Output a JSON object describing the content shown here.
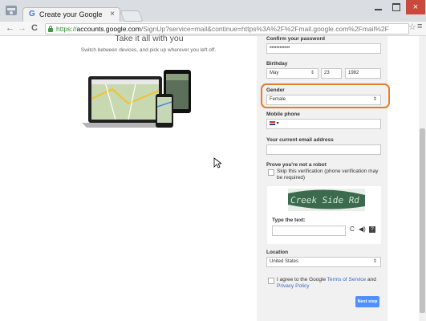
{
  "browser": {
    "tab_title": "Create your Google",
    "tab_close": "×",
    "favicon_letter": "G",
    "url_https": "https://",
    "url_host": "accounts.google.com",
    "url_rest": "/SignUp?service=mail&continue=https%3A%2F%2Fmail.google.com%2Fmail%2F",
    "back": "←",
    "forward": "→",
    "reload": "C",
    "close_glyph": "×"
  },
  "promo": {
    "headline": "Take it all with you",
    "subline": "Switch between devices, and pick up wherever you left off."
  },
  "form": {
    "confirm_password_label": "Confirm your password",
    "confirm_password_value": "••••••••••••",
    "birthday_label": "Birthday",
    "birth_month": "May",
    "birth_day": "23",
    "birth_year": "1982",
    "gender_label": "Gender",
    "gender_value": "Female",
    "mobile_label": "Mobile phone",
    "mobile_flag_caret": "▾",
    "email_label": "Your current email address",
    "robot_label": "Prove you're not a robot",
    "skip_verification": "Skip this verification (phone verification may be required)",
    "captcha_text": "Creek Side Rd",
    "type_text_label": "Type the text:",
    "location_label": "Location",
    "location_value": "United States",
    "agree_prefix": "I agree to the Google ",
    "agree_tos": "Terms of Service",
    "agree_and": " and",
    "agree_privacy": "Privacy Policy",
    "next_button": "Next step",
    "select_arrow": "⇕"
  },
  "colors": {
    "highlight": "#e07f2c",
    "next_button": "#4d90fe",
    "link": "#3366cc"
  }
}
